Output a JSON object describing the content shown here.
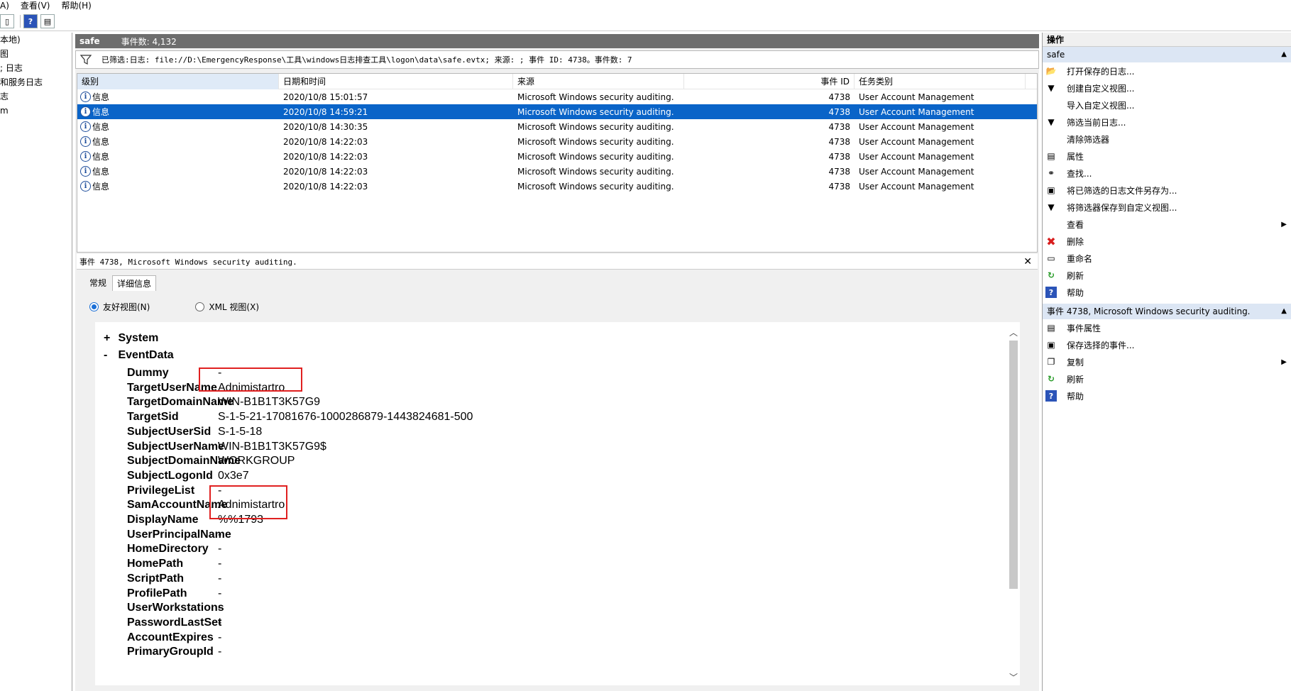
{
  "menubar": {
    "items": [
      "A)",
      "查看(V)",
      "帮助(H)"
    ]
  },
  "left_tree": {
    "items": [
      "本地)",
      "图",
      "; 日志",
      "和服务日志",
      "志",
      "m"
    ]
  },
  "log_header": {
    "name": "safe",
    "count_text": "事件数: 4,132"
  },
  "filter": {
    "text": "已筛选:日志: file://D:\\EmergencyResponse\\工具\\windows日志排查工具\\logon\\data\\safe.evtx; 来源: ; 事件 ID: 4738。事件数: 7"
  },
  "grid": {
    "columns": {
      "level": "级别",
      "date": "日期和时间",
      "source": "来源",
      "event_id": "事件 ID",
      "task": "任务类别"
    },
    "rows": [
      {
        "level": "信息",
        "date": "2020/10/8 15:01:57",
        "source": "Microsoft Windows security auditing.",
        "event_id": "4738",
        "task": "User Account Management"
      },
      {
        "level": "信息",
        "date": "2020/10/8 14:59:21",
        "source": "Microsoft Windows security auditing.",
        "event_id": "4738",
        "task": "User Account Management"
      },
      {
        "level": "信息",
        "date": "2020/10/8 14:30:35",
        "source": "Microsoft Windows security auditing.",
        "event_id": "4738",
        "task": "User Account Management"
      },
      {
        "level": "信息",
        "date": "2020/10/8 14:22:03",
        "source": "Microsoft Windows security auditing.",
        "event_id": "4738",
        "task": "User Account Management"
      },
      {
        "level": "信息",
        "date": "2020/10/8 14:22:03",
        "source": "Microsoft Windows security auditing.",
        "event_id": "4738",
        "task": "User Account Management"
      },
      {
        "level": "信息",
        "date": "2020/10/8 14:22:03",
        "source": "Microsoft Windows security auditing.",
        "event_id": "4738",
        "task": "User Account Management"
      },
      {
        "level": "信息",
        "date": "2020/10/8 14:22:03",
        "source": "Microsoft Windows security auditing.",
        "event_id": "4738",
        "task": "User Account Management"
      }
    ]
  },
  "detail": {
    "title": "事件 4738, Microsoft Windows security auditing.",
    "close": "✕",
    "tabs": [
      "常规",
      "详细信息"
    ],
    "radio_friendly": "友好视图(N)",
    "radio_xml": "XML 视图(X)",
    "system_label": "System",
    "system_sym": "+",
    "eventdata_label": "EventData",
    "eventdata_sym": "-",
    "fields": [
      {
        "name": "Dummy",
        "value": "-"
      },
      {
        "name": "TargetUserName",
        "value": "Adnimistartro"
      },
      {
        "name": "TargetDomainName",
        "value": "WIN-B1B1T3K57G9"
      },
      {
        "name": "TargetSid",
        "value": "S-1-5-21-17081676-1000286879-1443824681-500"
      },
      {
        "name": "SubjectUserSid",
        "value": "S-1-5-18"
      },
      {
        "name": "SubjectUserName",
        "value": "WIN-B1B1T3K57G9$"
      },
      {
        "name": "SubjectDomainName",
        "value": "WORKGROUP"
      },
      {
        "name": "SubjectLogonId",
        "value": "0x3e7"
      },
      {
        "name": "PrivilegeList",
        "value": "-"
      },
      {
        "name": "SamAccountName",
        "value": "Adnimistartro"
      },
      {
        "name": "DisplayName",
        "value": "%%1793"
      },
      {
        "name": "UserPrincipalName",
        "value": "-"
      },
      {
        "name": "HomeDirectory",
        "value": "-"
      },
      {
        "name": "HomePath",
        "value": "-"
      },
      {
        "name": "ScriptPath",
        "value": "-"
      },
      {
        "name": "ProfilePath",
        "value": "-"
      },
      {
        "name": "UserWorkstations",
        "value": "-"
      },
      {
        "name": "PasswordLastSet",
        "value": "-"
      },
      {
        "name": "AccountExpires",
        "value": "-"
      },
      {
        "name": "PrimaryGroupId",
        "value": "-"
      }
    ]
  },
  "actions": {
    "title": "操作",
    "section1": "safe",
    "items1": [
      {
        "label": "打开保存的日志...",
        "icon": "folder-icon"
      },
      {
        "label": "创建自定义视图...",
        "icon": "filter-create-icon"
      },
      {
        "label": "导入自定义视图...",
        "icon": "none"
      },
      {
        "label": "筛选当前日志...",
        "icon": "filter-icon"
      },
      {
        "label": "清除筛选器",
        "icon": "none"
      },
      {
        "label": "属性",
        "icon": "properties-icon"
      },
      {
        "label": "查找...",
        "icon": "binoculars-icon"
      },
      {
        "label": "将已筛选的日志文件另存为...",
        "icon": "save-icon"
      },
      {
        "label": "将筛选器保存到自定义视图...",
        "icon": "filter-save-icon"
      },
      {
        "label": "查看",
        "icon": "none"
      },
      {
        "label": "删除",
        "icon": "delete-icon"
      },
      {
        "label": "重命名",
        "icon": "rename-icon"
      },
      {
        "label": "刷新",
        "icon": "refresh-icon"
      },
      {
        "label": "帮助",
        "icon": "help-icon"
      }
    ],
    "section2": "事件 4738, Microsoft Windows security auditing.",
    "items2": [
      {
        "label": "事件属性",
        "icon": "properties-icon"
      },
      {
        "label": "保存选择的事件...",
        "icon": "save-icon"
      },
      {
        "label": "复制",
        "icon": "copy-icon"
      },
      {
        "label": "刷新",
        "icon": "refresh-icon"
      },
      {
        "label": "帮助",
        "icon": "help-icon"
      }
    ],
    "caret_up": "▲",
    "submenu_arrow": "▶"
  },
  "colors": {
    "selection": "#0a64c8",
    "highlight_box": "#e02020",
    "header_bg": "#6d6d6d"
  }
}
